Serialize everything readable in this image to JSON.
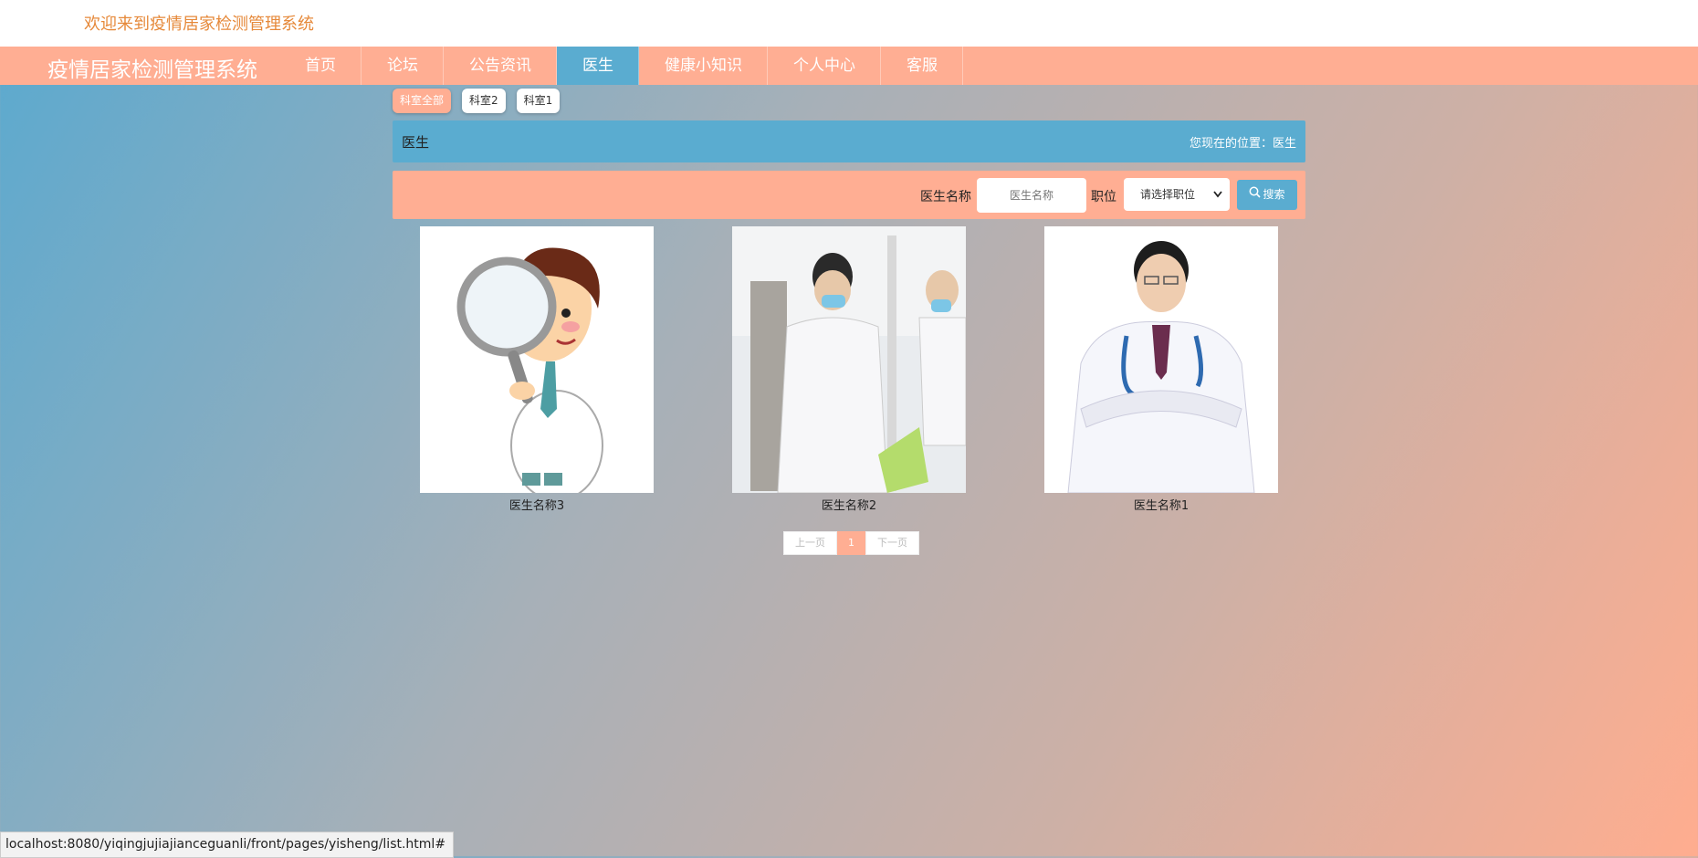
{
  "header": {
    "welcome": "欢迎来到疫情居家检测管理系统"
  },
  "nav": {
    "brand": "疫情居家检测管理系统",
    "items": [
      {
        "label": "首页"
      },
      {
        "label": "论坛"
      },
      {
        "label": "公告资讯"
      },
      {
        "label": "医生",
        "active": true
      },
      {
        "label": "健康小知识"
      },
      {
        "label": "个人中心"
      },
      {
        "label": "客服"
      }
    ]
  },
  "filters": [
    {
      "label": "科室全部",
      "active": true
    },
    {
      "label": "科室2"
    },
    {
      "label": "科室1"
    }
  ],
  "breadcrumb": {
    "title": "医生",
    "location": "您现在的位置：医生"
  },
  "search": {
    "name_label": "医生名称",
    "name_placeholder": "医生名称",
    "position_label": "职位",
    "position_selected": "请选择职位",
    "button_label": "搜索"
  },
  "doctors": [
    {
      "name": "医生名称3",
      "image": "cartoon-doctor-magnifier"
    },
    {
      "name": "医生名称2",
      "image": "doctors-in-ward-photo"
    },
    {
      "name": "医生名称1",
      "image": "doctor-portrait-photo"
    }
  ],
  "pagination": {
    "prev": "上一页",
    "current": "1",
    "next": "下一页"
  },
  "statusbar": {
    "url": "localhost:8080/yiqingjujiajianceguanli/front/pages/yisheng/list.html#"
  },
  "colors": {
    "accent_orange": "#ffae93",
    "accent_blue": "#5aacd0",
    "welcome_text": "#e6893a"
  }
}
